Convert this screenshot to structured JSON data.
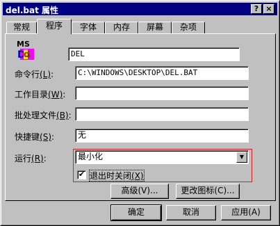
{
  "window": {
    "title": "del.bat 属性",
    "help_button": "?",
    "close_button": "×"
  },
  "tabs": [
    {
      "label": "常规"
    },
    {
      "label": "程序"
    },
    {
      "label": "字体"
    },
    {
      "label": "内存"
    },
    {
      "label": "屏幕"
    },
    {
      "label": "杂项"
    }
  ],
  "program": {
    "icon_text": "MS DOS",
    "name_value": "DEL",
    "cmdline_label": "命令行",
    "cmdline_key": "(L)",
    "cmdline_value": "C:\\WINDOWS\\DESKTOP\\DEL.BAT",
    "workdir_label": "工作目录",
    "workdir_key": "(W)",
    "workdir_value": "",
    "batch_label": "批处理文件",
    "batch_key": "(B)",
    "batch_value": "",
    "shortcut_label": "快捷键",
    "shortcut_key": "(S)",
    "shortcut_value": "无",
    "run_label": "运行",
    "run_key": "(R)",
    "run_value": "最小化",
    "close_on_exit_label": "退出时关闭",
    "close_on_exit_key": "(X)",
    "close_on_exit_checked": true,
    "advanced_button": "高级(V)...",
    "change_icon_button": "更改图标(C)..."
  },
  "footer": {
    "ok": "确定",
    "cancel": "取消",
    "apply": "应用(A)"
  },
  "colors": {
    "titlebar": "#000080",
    "highlight_box": "#e02020"
  }
}
